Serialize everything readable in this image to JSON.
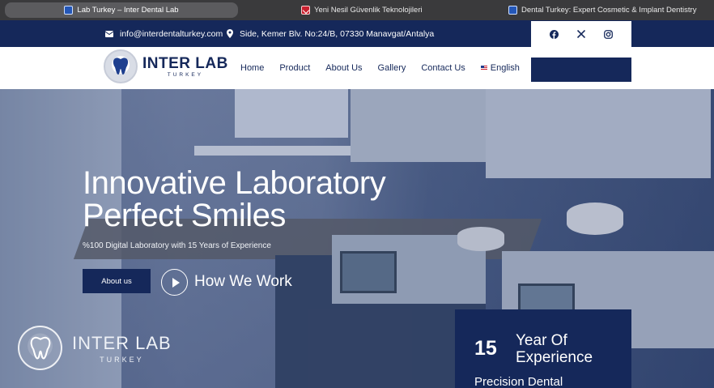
{
  "browser": {
    "tabs": [
      {
        "label": "Lab Turkey – Inter Dental Lab",
        "active": true,
        "favicon": "blue"
      },
      {
        "label": "Yeni Nesil Güvenlik Teknolojileri",
        "active": false,
        "favicon": "red"
      },
      {
        "label": "Dental Turkey: Expert Cosmetic & Implant Dentistry",
        "active": false,
        "favicon": "blue"
      }
    ]
  },
  "topbar": {
    "email": "info@interdentalturkey.com",
    "address": "Side, Kemer Blv. No:24/B, 07330 Manavgat/Antalya",
    "social": [
      "facebook-icon",
      "x-icon",
      "instagram-icon"
    ]
  },
  "header": {
    "logo_title": "INTER LAB",
    "logo_subtitle": "TURKEY",
    "nav": [
      "Home",
      "Product",
      "About Us",
      "Gallery",
      "Contact Us",
      "English"
    ]
  },
  "hero": {
    "title_line1": "Innovative Laboratory",
    "title_line2": "Perfect Smiles",
    "subtitle": "%100 Digital Laboratory with 15 Years of Experience",
    "about_button": "About us",
    "how_we_work": "How We Work",
    "bottom_logo_title": "INTER LAB",
    "bottom_logo_subtitle": "TURKEY"
  },
  "experience": {
    "number": "15",
    "label_line1": "Year Of",
    "label_line2": "Experience",
    "extra": "Precision Dental"
  },
  "colors": {
    "navy": "#15285a",
    "tabbar": "#3a3a3c"
  }
}
